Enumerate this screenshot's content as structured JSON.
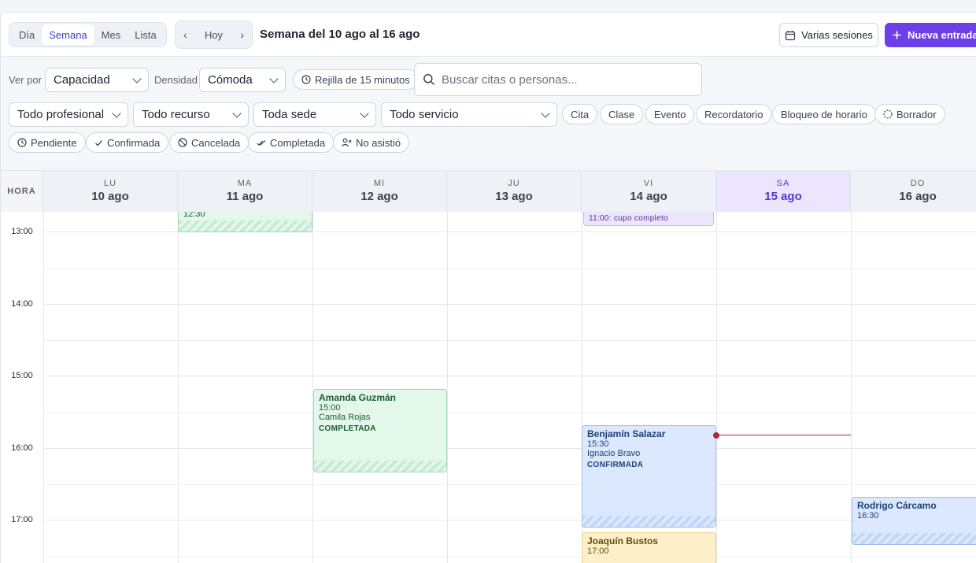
{
  "view_tabs": [
    "Día",
    "Semana",
    "Mes",
    "Lista"
  ],
  "nav": {
    "prev": "‹",
    "today": "Hoy",
    "next": "›"
  },
  "week_title": "Semana del 10 ago al 16 ago",
  "actions": {
    "sessions": "Varias sesiones",
    "new_entry": "Nueva entrada"
  },
  "filters": {
    "view_by_label": "Ver por",
    "view_by_value": "Capacidad",
    "density_label": "Densidad",
    "density_value": "Cómoda",
    "grid_pill": "Rejilla de 15 minutos",
    "search_placeholder": "Buscar citas o personas...",
    "professional": "Todo profesional",
    "resource": "Todo recurso",
    "site": "Toda sede",
    "service": "Todo servicio",
    "types": [
      "Cita",
      "Clase",
      "Evento",
      "Recordatorio",
      "Bloqueo de horario",
      "Borrador"
    ],
    "statuses": [
      "Pendiente",
      "Confirmada",
      "Cancelada",
      "Completada",
      "No asistió"
    ]
  },
  "calendar": {
    "hour_header": "HORA",
    "days": [
      {
        "dn": "LU",
        "dd": "10 ago"
      },
      {
        "dn": "MA",
        "dd": "11 ago"
      },
      {
        "dn": "MI",
        "dd": "12 ago"
      },
      {
        "dn": "JU",
        "dd": "13 ago"
      },
      {
        "dn": "VI",
        "dd": "14 ago"
      },
      {
        "dn": "SA",
        "dd": "15 ago"
      },
      {
        "dn": "DO",
        "dd": "16 ago"
      }
    ],
    "hours": [
      "13:00",
      "14:00",
      "15:00",
      "16:00",
      "17:00"
    ],
    "events": {
      "tue_partial": {
        "time": "12:30"
      },
      "fri_partial": {
        "text": "11:00: cupo completo"
      },
      "amanda": {
        "name": "Amanda Guzmán",
        "time": "15:00",
        "with": "Camila Rojas",
        "status": "COMPLETADA"
      },
      "benjamin": {
        "name": "Benjamín Salazar",
        "time": "15:30",
        "with": "Ignacio Bravo",
        "status": "CONFIRMADA"
      },
      "rodrigo": {
        "name": "Rodrigo Cárcamo",
        "time": "16:30"
      },
      "joaquin": {
        "name": "Joaquín Bustos",
        "time": "17:00"
      }
    }
  },
  "colors": {
    "accent": "#6d3fe6",
    "today_bg": "#ebe5fd",
    "now_line": "#b3243a"
  }
}
